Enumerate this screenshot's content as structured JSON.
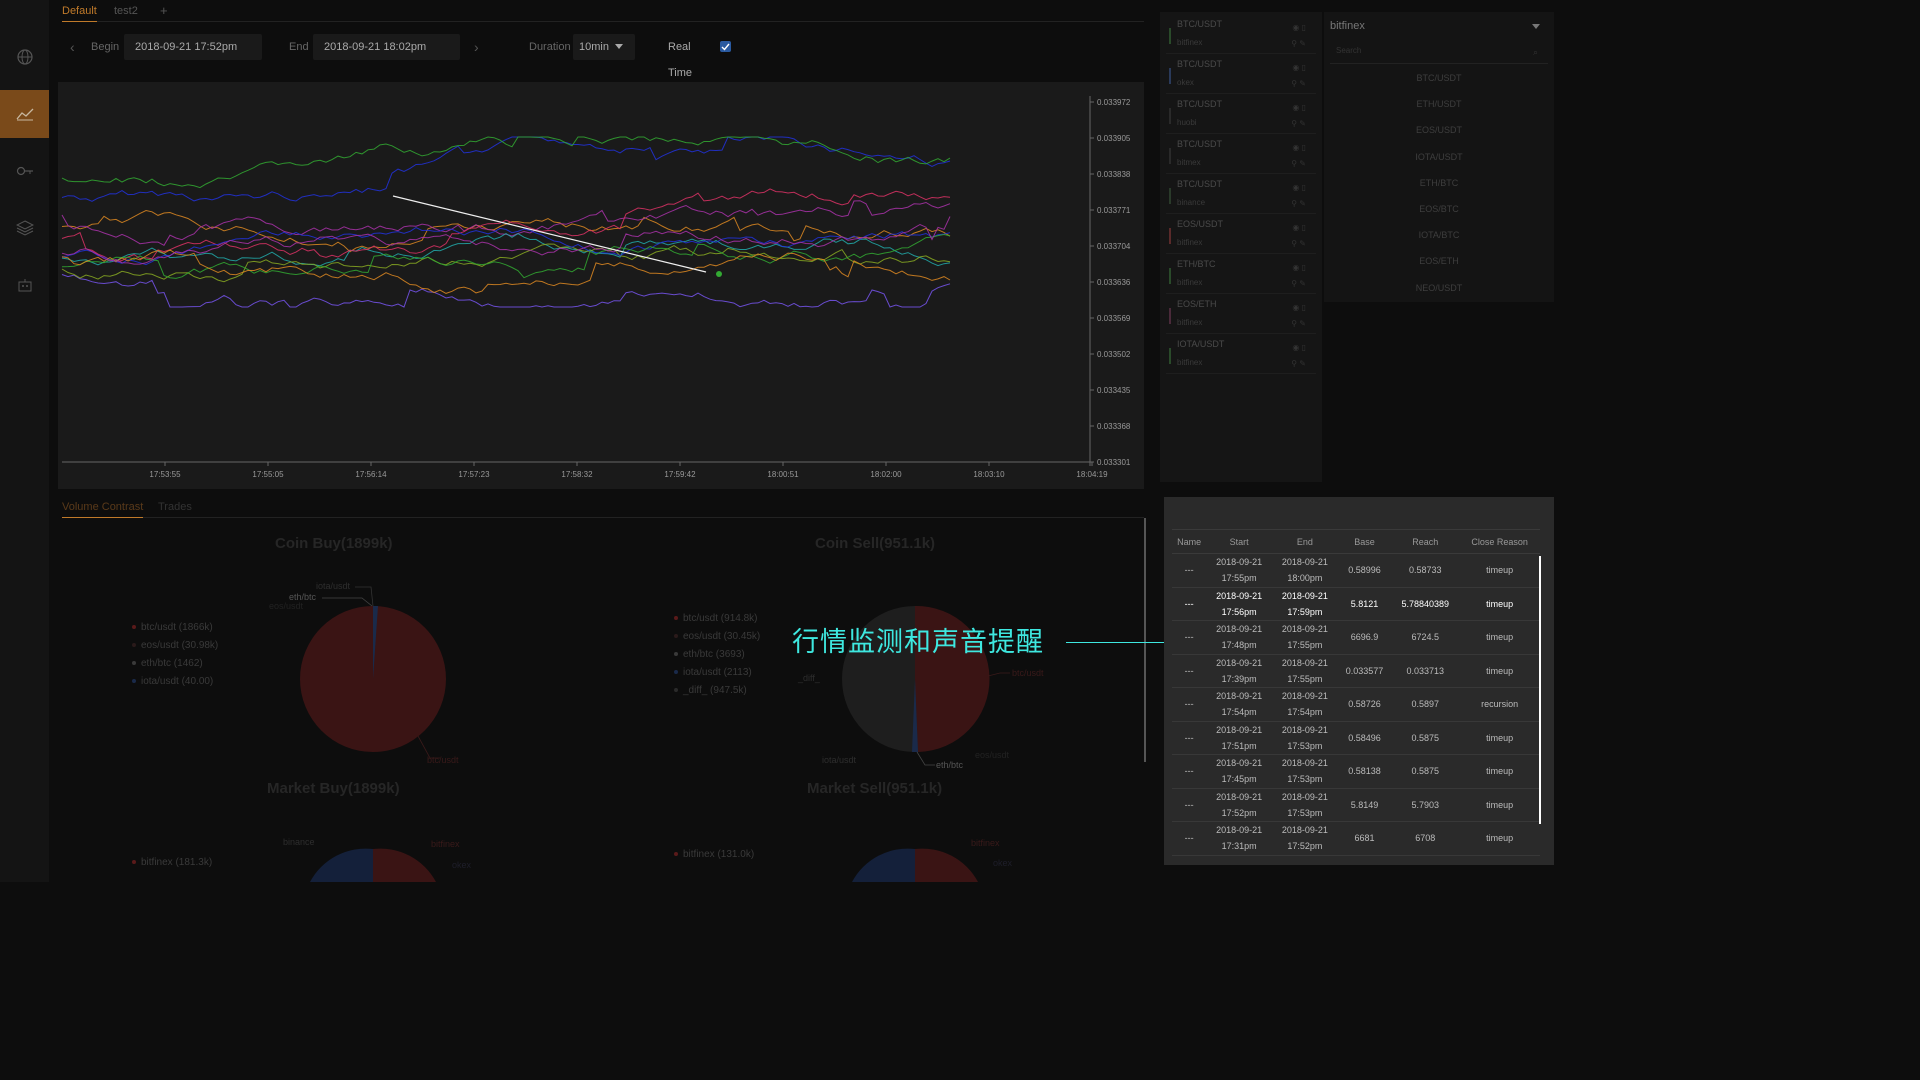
{
  "tabs": [
    {
      "label": "Default"
    },
    {
      "label": "test2"
    }
  ],
  "add_tab": "+",
  "controls": {
    "prev": "‹",
    "begin_label": "Begin",
    "begin_value": "2018-09-21 17:52pm",
    "end_label": "End",
    "end_value": "2018-09-21 18:02pm",
    "next": "›",
    "duration_label": "Duration",
    "duration_value": "10min",
    "realtime_label": "Real Time",
    "realtime_checked": true
  },
  "chart_data": {
    "type": "line",
    "title": "",
    "x_ticks": [
      "17:53:55",
      "17:55:05",
      "17:56:14",
      "17:57:23",
      "17:58:32",
      "17:59:42",
      "18:00:51",
      "18:02:00",
      "18:03:10",
      "18:04:19"
    ],
    "y_ticks": [
      "0.033972",
      "0.033905",
      "0.033838",
      "0.033771",
      "0.033704",
      "0.033636",
      "0.033569",
      "0.033502",
      "0.033435",
      "0.033368",
      "0.033301"
    ],
    "ylim": [
      0.033301,
      0.033972
    ],
    "series_colors": [
      "#2233dd",
      "#33aa33",
      "#dd8822",
      "#aa33aa",
      "#22aaaa",
      "#dd3366",
      "#7755ee",
      "#88aa22",
      "#ffffff"
    ]
  },
  "pairs": [
    {
      "name": "BTC/USDT",
      "exchange": "bitfinex",
      "color": "#2a4a2a"
    },
    {
      "name": "BTC/USDT",
      "exchange": "okex",
      "color": "#2a3a5a"
    },
    {
      "name": "BTC/USDT",
      "exchange": "huobi",
      "color": "#2a2a2a"
    },
    {
      "name": "BTC/USDT",
      "exchange": "bitmex",
      "color": "#2a2a2a"
    },
    {
      "name": "BTC/USDT",
      "exchange": "binance",
      "color": "#2a3a2a"
    },
    {
      "name": "EOS/USDT",
      "exchange": "bitfinex",
      "color": "#5a2a2a"
    },
    {
      "name": "ETH/BTC",
      "exchange": "bitfinex",
      "color": "#2a4a2a"
    },
    {
      "name": "EOS/ETH",
      "exchange": "bitfinex",
      "color": "#4a2a3a"
    },
    {
      "name": "IOTA/USDT",
      "exchange": "bitfinex",
      "color": "#2a4a2a"
    }
  ],
  "exchange_select": {
    "value": "bitfinex"
  },
  "search": {
    "placeholder": "Search"
  },
  "exchange_pairs": [
    "BTC/USDT",
    "ETH/USDT",
    "EOS/USDT",
    "IOTA/USDT",
    "ETH/BTC",
    "EOS/BTC",
    "IOTA/BTC",
    "EOS/ETH",
    "NEO/USDT"
  ],
  "bottom_tabs": [
    {
      "label": "Volume Contrast"
    },
    {
      "label": "Trades"
    }
  ],
  "pies": {
    "coin_buy": {
      "title": "Coin Buy(1899k)",
      "legend": [
        {
          "label": "btc/usdt (1866k)",
          "color": "#5a1a1a"
        },
        {
          "label": "eos/usdt (30.98k)",
          "color": "#2a1a1a"
        },
        {
          "label": "eth/btc (1462)",
          "color": "#3a3a3a"
        },
        {
          "label": "iota/usdt (40.00)",
          "color": "#1a2a4a"
        }
      ],
      "slice_labels": {
        "a": "iota/usdt",
        "b": "eth/btc",
        "c": "eos/usdt",
        "d": "btc/usdt"
      }
    },
    "coin_sell": {
      "title": "Coin Sell(951.1k)",
      "legend": [
        {
          "label": "btc/usdt (914.8k)",
          "color": "#5a1a1a"
        },
        {
          "label": "eos/usdt (30.45k)",
          "color": "#2a1a1a"
        },
        {
          "label": "eth/btc (3693)",
          "color": "#3a3a3a"
        },
        {
          "label": "iota/usdt (2113)",
          "color": "#1a2a4a"
        },
        {
          "label": "_diff_ (947.5k)",
          "color": "#2a2a2a"
        }
      ],
      "slice_labels": {
        "a": "_diff_",
        "b": "btc/usdt",
        "c": "iota/usdt",
        "d": "eth/btc",
        "e": "eos/usdt"
      }
    },
    "market_buy": {
      "title": "Market Buy(1899k)",
      "legend": [
        {
          "label": "bitfinex (181.3k)",
          "color": "#5a1a1a"
        }
      ],
      "slice_labels": {
        "a": "binance",
        "b": "bitfinex",
        "c": "okex"
      }
    },
    "market_sell": {
      "title": "Market Sell(951.1k)",
      "legend": [
        {
          "label": "bitfinex (131.0k)",
          "color": "#5a1a1a"
        }
      ],
      "slice_labels": {
        "a": "bitfinex",
        "b": "okex"
      }
    }
  },
  "alert_table": {
    "headers": [
      "Name",
      "Start",
      "End",
      "Base",
      "Reach",
      "Close Reason"
    ],
    "rows": [
      {
        "name": "---",
        "start_d": "2018-09-21",
        "start_t": "17:55pm",
        "end_d": "2018-09-21",
        "end_t": "18:00pm",
        "base": "0.58996",
        "reach": "0.58733",
        "reason": "timeup"
      },
      {
        "name": "---",
        "start_d": "2018-09-21",
        "start_t": "17:56pm",
        "end_d": "2018-09-21",
        "end_t": "17:59pm",
        "base": "5.8121",
        "reach": "5.78840389",
        "reason": "timeup"
      },
      {
        "name": "---",
        "start_d": "2018-09-21",
        "start_t": "17:48pm",
        "end_d": "2018-09-21",
        "end_t": "17:55pm",
        "base": "6696.9",
        "reach": "6724.5",
        "reason": "timeup"
      },
      {
        "name": "---",
        "start_d": "2018-09-21",
        "start_t": "17:39pm",
        "end_d": "2018-09-21",
        "end_t": "17:55pm",
        "base": "0.033577",
        "reach": "0.033713",
        "reason": "timeup"
      },
      {
        "name": "---",
        "start_d": "2018-09-21",
        "start_t": "17:54pm",
        "end_d": "2018-09-21",
        "end_t": "17:54pm",
        "base": "0.58726",
        "reach": "0.5897",
        "reason": "recursion"
      },
      {
        "name": "---",
        "start_d": "2018-09-21",
        "start_t": "17:51pm",
        "end_d": "2018-09-21",
        "end_t": "17:53pm",
        "base": "0.58496",
        "reach": "0.5875",
        "reason": "timeup"
      },
      {
        "name": "---",
        "start_d": "2018-09-21",
        "start_t": "17:45pm",
        "end_d": "2018-09-21",
        "end_t": "17:53pm",
        "base": "0.58138",
        "reach": "0.5875",
        "reason": "timeup"
      },
      {
        "name": "---",
        "start_d": "2018-09-21",
        "start_t": "17:52pm",
        "end_d": "2018-09-21",
        "end_t": "17:53pm",
        "base": "5.8149",
        "reach": "5.7903",
        "reason": "timeup"
      },
      {
        "name": "---",
        "start_d": "2018-09-21",
        "start_t": "17:31pm",
        "end_d": "2018-09-21",
        "end_t": "17:52pm",
        "base": "6681",
        "reach": "6708",
        "reason": "timeup"
      }
    ]
  },
  "annotation": "行情监测和声音提醒",
  "colors": {
    "accent": "#c07a2a",
    "annotation": "#3ee8e0",
    "pie_red": "#3a1414"
  }
}
